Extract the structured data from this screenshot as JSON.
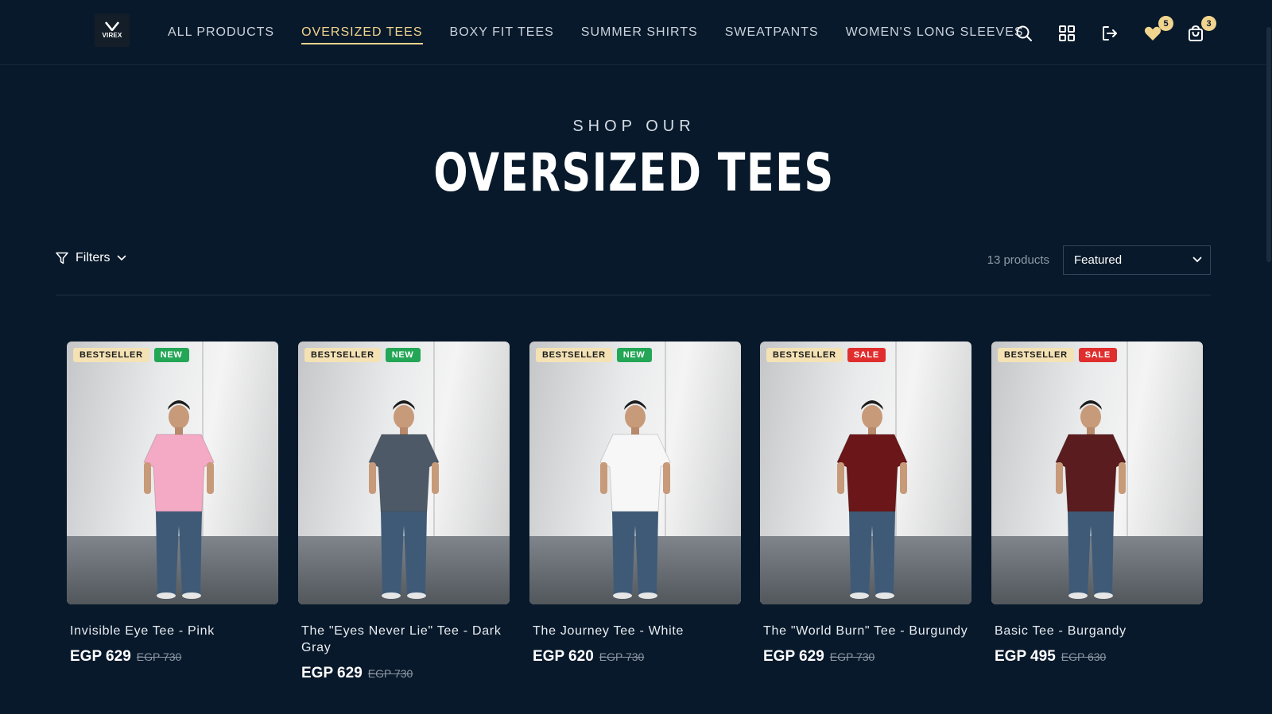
{
  "brand": {
    "logo_text": "VIREX"
  },
  "nav": [
    {
      "label": "ALL PRODUCTS"
    },
    {
      "label": "OVERSIZED TEES",
      "active": true
    },
    {
      "label": "BOXY FIT TEES"
    },
    {
      "label": "SUMMER SHIRTS"
    },
    {
      "label": "SWEATPANTS"
    },
    {
      "label": "WOMEN'S LONG SLEEVES"
    }
  ],
  "header_icons": {
    "search": "search-icon",
    "account": "grid-icon",
    "logout": "logout-icon",
    "wishlist": {
      "icon": "heart-icon",
      "count": "5"
    },
    "cart": {
      "icon": "bag-icon",
      "count": "3"
    }
  },
  "hero": {
    "eyebrow": "SHOP OUR",
    "title": "OVERSIZED TEES"
  },
  "toolbar": {
    "filters_label": "Filters",
    "product_count": "13 products",
    "sort_selected": "Featured"
  },
  "colors": {
    "background": "#08192b",
    "accent": "#f1d48e",
    "badge_bestseller": "#f4e2b5",
    "badge_new": "#23a655",
    "badge_sale": "#e02e2e"
  },
  "products": [
    {
      "name": "Invisible Eye Tee - Pink",
      "price": "EGP 629",
      "compare_price": "EGP 730",
      "badges": [
        "BESTSELLER",
        "NEW"
      ],
      "shirt_color": "#f4a9c4"
    },
    {
      "name": "The \"Eyes Never Lie\" Tee - Dark Gray",
      "price": "EGP 629",
      "compare_price": "EGP 730",
      "badges": [
        "BESTSELLER",
        "NEW"
      ],
      "shirt_color": "#4d5966"
    },
    {
      "name": "The Journey Tee - White",
      "price": "EGP 620",
      "compare_price": "EGP 730",
      "badges": [
        "BESTSELLER",
        "NEW"
      ],
      "shirt_color": "#f7f7f7"
    },
    {
      "name": "The \"World Burn\" Tee - Burgundy",
      "price": "EGP 629",
      "compare_price": "EGP 730",
      "badges": [
        "BESTSELLER",
        "SALE"
      ],
      "shirt_color": "#6b1618"
    },
    {
      "name": "Basic Tee - Burgandy",
      "price": "EGP 495",
      "compare_price": "EGP 630",
      "badges": [
        "BESTSELLER",
        "SALE"
      ],
      "shirt_color": "#5a1c1e"
    }
  ]
}
